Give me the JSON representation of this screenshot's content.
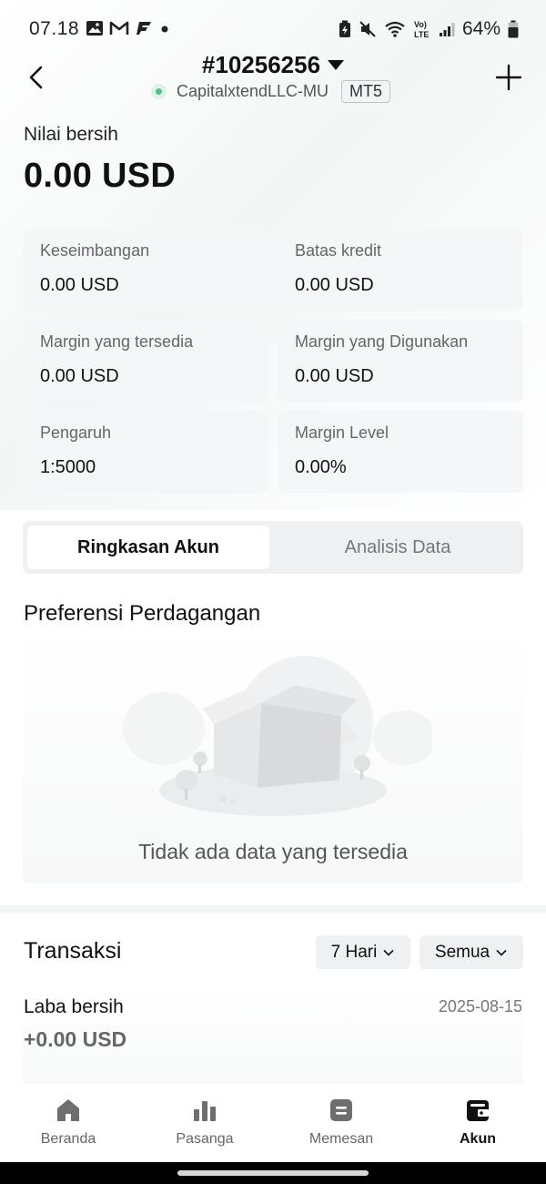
{
  "status_bar": {
    "time": "07.18",
    "battery": "64%",
    "icons": [
      "gallery-icon",
      "gmail-icon",
      "app-f-icon",
      "dot-icon",
      "battery-saver-icon",
      "mute-icon",
      "wifi-icon",
      "volte-icon",
      "signal-icon",
      "battery-icon"
    ]
  },
  "header": {
    "account_number": "#10256256",
    "server": "CapitalxtendLLC-MU",
    "platform_badge": "MT5"
  },
  "net_value": {
    "label": "Nilai bersih",
    "value": "0.00 USD"
  },
  "stats": [
    {
      "label": "Keseimbangan",
      "value": "0.00 USD"
    },
    {
      "label": "Batas kredit",
      "value": "0.00 USD"
    },
    {
      "label": "Margin yang tersedia",
      "value": "0.00 USD"
    },
    {
      "label": "Margin yang Digunakan",
      "value": "0.00 USD"
    },
    {
      "label": "Pengaruh",
      "value": "1:5000"
    },
    {
      "label": "Margin Level",
      "value": "0.00%"
    }
  ],
  "tabs": [
    {
      "label": "Ringkasan Akun",
      "active": true
    },
    {
      "label": "Analisis Data",
      "active": false
    }
  ],
  "preferences": {
    "title": "Preferensi Perdagangan",
    "empty_text": "Tidak ada data yang tersedia"
  },
  "transactions": {
    "title": "Transaksi",
    "period_filter": "7 Hari",
    "type_filter": "Semua",
    "net_profit_label": "Laba bersih",
    "date": "2025-08-15",
    "net_profit_value": "+0.00 USD"
  },
  "bottom_nav": [
    {
      "label": "Beranda",
      "icon": "home-icon",
      "active": false
    },
    {
      "label": "Pasanga",
      "icon": "bar-chart-icon",
      "active": false
    },
    {
      "label": "Memesan",
      "icon": "order-icon",
      "active": false
    },
    {
      "label": "Akun",
      "icon": "wallet-icon",
      "active": true
    }
  ],
  "colors": {
    "online_dot": "#4cc38a",
    "card_bg": "#f5f6f7",
    "active_text": "#111111",
    "muted_text": "#777777"
  }
}
